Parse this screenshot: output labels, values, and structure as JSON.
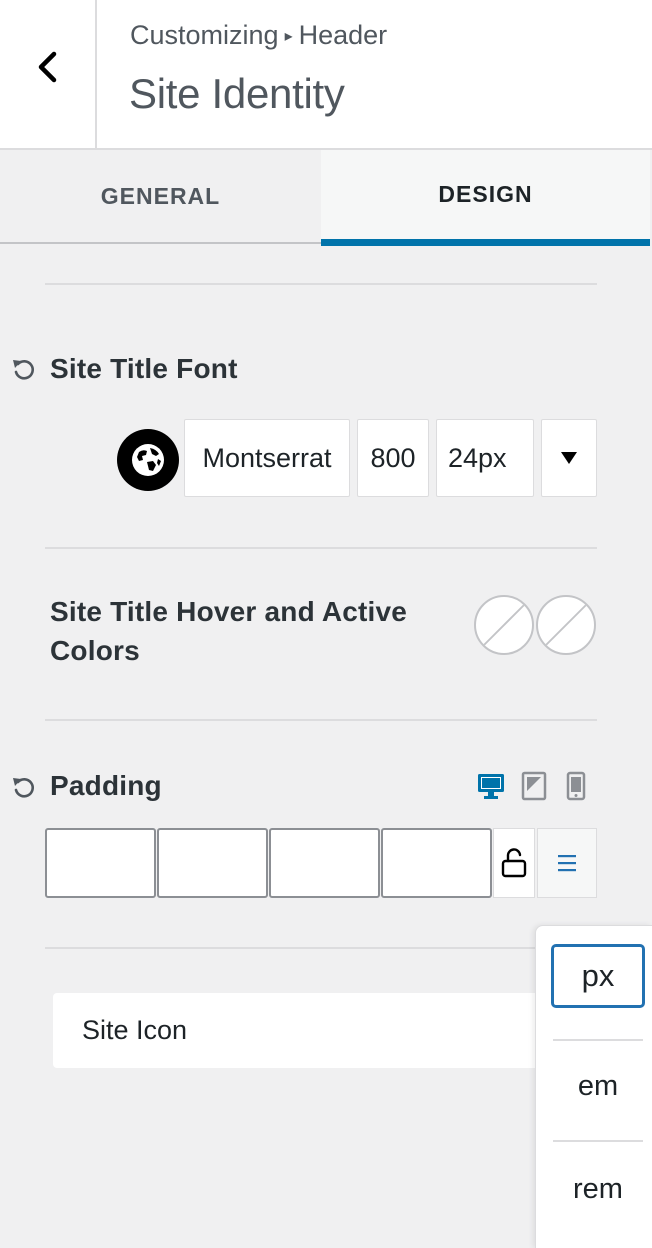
{
  "header": {
    "breadcrumb_root": "Customizing",
    "breadcrumb_separator": "▸",
    "breadcrumb_section": "Header",
    "title": "Site Identity"
  },
  "tabs": [
    {
      "label": "GENERAL",
      "active": false
    },
    {
      "label": "DESIGN",
      "active": true
    }
  ],
  "site_title_font": {
    "label": "Site Title Font",
    "family": "Montserrat",
    "weight": "800",
    "size": "24px"
  },
  "hover_colors": {
    "label_line1": "Site Title Hover and Active",
    "label_line2": "Colors"
  },
  "padding": {
    "label": "Padding",
    "values": [
      "",
      "",
      "",
      ""
    ]
  },
  "site_icon": {
    "label": "Site Icon"
  },
  "units": {
    "options": [
      "px",
      "em",
      "rem"
    ],
    "selected": "px"
  },
  "colors": {
    "accent": "#0073aa",
    "device_active": "#0073aa",
    "device_inactive": "#8c8f94"
  },
  "icons": {
    "back": "chevron-left-icon",
    "reset": "reset-icon",
    "globe": "globe-icon",
    "dropdown": "caret-down-icon",
    "desktop": "desktop-icon",
    "tablet": "tablet-icon",
    "mobile": "mobile-icon",
    "lock": "unlock-icon",
    "units": "menu-icon"
  }
}
